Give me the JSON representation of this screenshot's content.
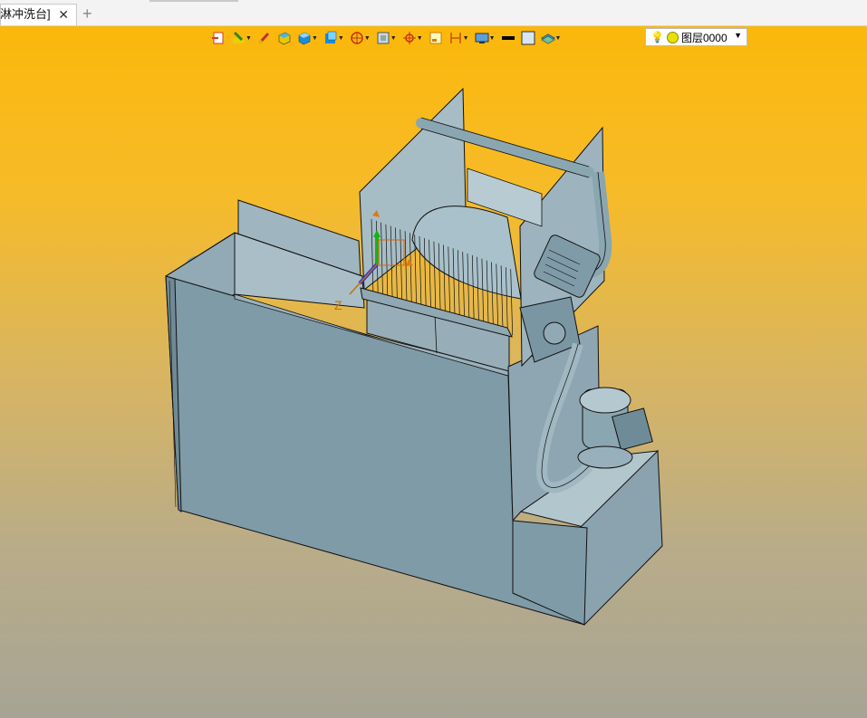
{
  "tab": {
    "title": "淋冲洗台]",
    "close": "✕",
    "new": "+"
  },
  "toolbar": {
    "layer_name": "图层0000",
    "icons": [
      "exit-sketch-icon",
      "sketch-tools-icon",
      "brush-icon",
      "solid-box-icon",
      "cube-icon",
      "view-cube-icon",
      "render-mode-icon",
      "section-view-icon",
      "frame-icon",
      "origin-icon",
      "dimension-icon",
      "measure-icon",
      "display-icon",
      "line-color-icon",
      "fill-color-icon",
      "layer-stack-icon"
    ]
  },
  "triad": {
    "z_label": "Z"
  },
  "colors": {
    "viewport_top": "#fbb80b",
    "viewport_bottom": "#a7a495",
    "model": "#7e9aa6"
  }
}
